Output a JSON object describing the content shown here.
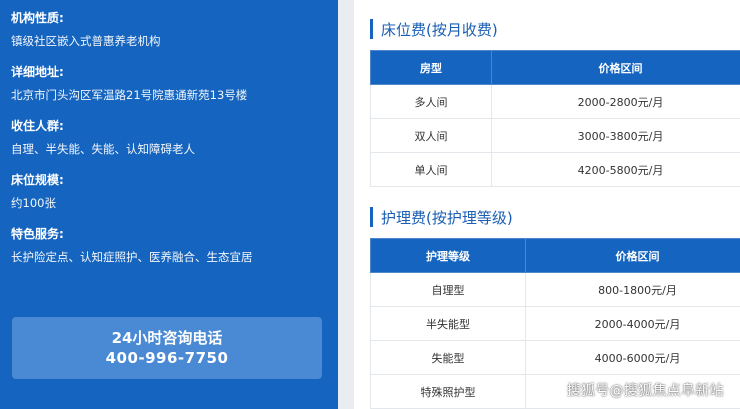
{
  "info": [
    {
      "label": "机构性质:",
      "value": "镇级社区嵌入式普惠养老机构"
    },
    {
      "label": "详细地址:",
      "value": "北京市门头沟区军温路21号院惠通新苑13号楼"
    },
    {
      "label": "收住人群:",
      "value": "自理、半失能、失能、认知障碍老人"
    },
    {
      "label": "床位规模:",
      "value": "约100张"
    },
    {
      "label": "特色服务:",
      "value": "长护险定点、认知症照护、医养融合、生态宜居"
    }
  ],
  "hotline": {
    "title": "24小时咨询电话",
    "number": "400-996-7750"
  },
  "bed_fee": {
    "title": "床位费(按月收费)",
    "headers": [
      "房型",
      "价格区间"
    ],
    "rows": [
      [
        "多人间",
        "2000-2800元/月"
      ],
      [
        "双人间",
        "3000-3800元/月"
      ],
      [
        "单人间",
        "4200-5800元/月"
      ]
    ]
  },
  "care_fee": {
    "title": "护理费(按护理等级)",
    "headers": [
      "护理等级",
      "价格区间"
    ],
    "rows": [
      [
        "自理型",
        "800-1800元/月"
      ],
      [
        "半失能型",
        "2000-4000元/月"
      ],
      [
        "失能型",
        "4000-6000元/月"
      ],
      [
        "特殊照护型",
        ""
      ]
    ]
  },
  "watermark": "搜狐号@搜狐焦点阜新站"
}
